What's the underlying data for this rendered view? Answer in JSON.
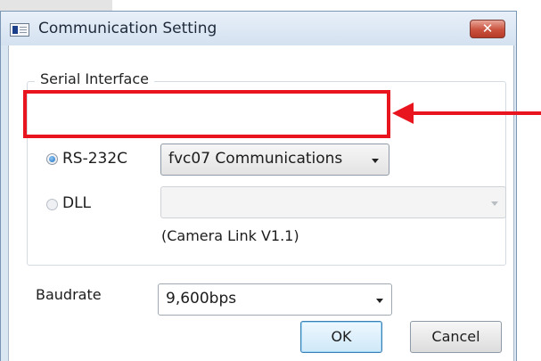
{
  "window": {
    "title": "Communication Setting",
    "close_glyph": "✕"
  },
  "serial_interface": {
    "group_label": "Serial Interface",
    "rs232c": {
      "label": "RS-232C",
      "selected": true,
      "port_value": "fvc07 Communications"
    },
    "dll": {
      "label": "DLL",
      "selected": false,
      "value": "",
      "note": "(Camera Link V1.1)"
    }
  },
  "baudrate": {
    "label": "Baudrate",
    "value": "9,600bps"
  },
  "buttons": {
    "ok": "OK",
    "cancel": "Cancel"
  },
  "annotation": {
    "color": "#e8141e"
  },
  "icons": {
    "app": "app-window-icon",
    "close": "close-icon",
    "dropdown": "chevron-down-icon"
  }
}
